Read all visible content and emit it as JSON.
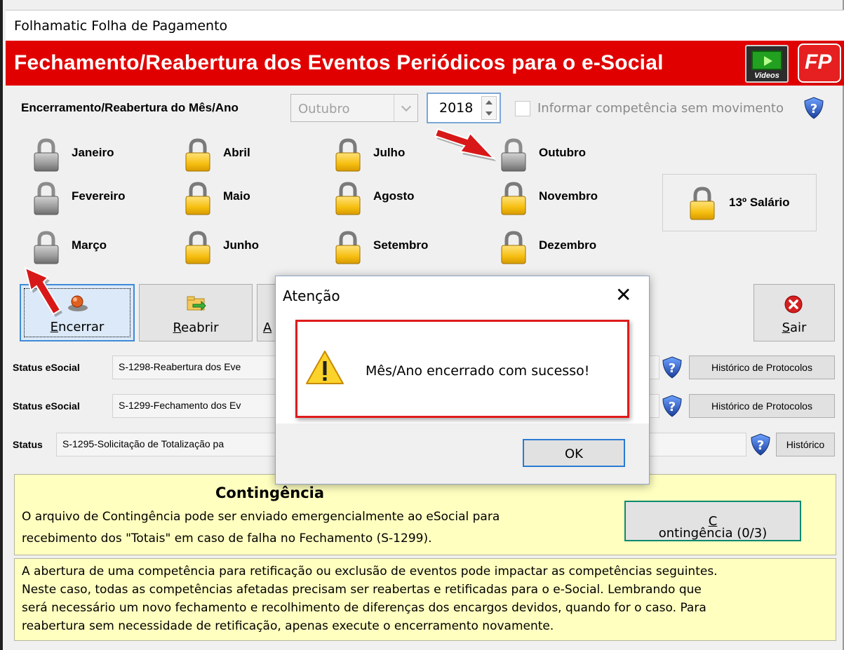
{
  "window": {
    "title": "Folhamatic Folha de Pagamento",
    "banner_title": "Fechamento/Reabertura dos Eventos Periódicos para o e-Social",
    "videos_label": "Videos",
    "fp_label": "FP"
  },
  "period": {
    "label": "Encerramento/Reabertura do Mês/Ano",
    "month_value": "Outubro",
    "year_value": "2018",
    "no_movement_label": "Informar competência sem movimento",
    "no_movement_checked": false
  },
  "months": [
    {
      "label": "Janeiro",
      "state": "closed"
    },
    {
      "label": "Fevereiro",
      "state": "closed"
    },
    {
      "label": "Março",
      "state": "closed"
    },
    {
      "label": "Abril",
      "state": "open"
    },
    {
      "label": "Maio",
      "state": "open"
    },
    {
      "label": "Junho",
      "state": "open"
    },
    {
      "label": "Julho",
      "state": "open"
    },
    {
      "label": "Agosto",
      "state": "open"
    },
    {
      "label": "Setembro",
      "state": "open"
    },
    {
      "label": "Outubro",
      "state": "closed"
    },
    {
      "label": "Novembro",
      "state": "open"
    },
    {
      "label": "Dezembro",
      "state": "open"
    }
  ],
  "salario13": {
    "label": "13º Salário",
    "state": "open"
  },
  "toolbar": {
    "encerrar": {
      "pre": "",
      "hot": "E",
      "post": "ncerrar"
    },
    "reabrir": {
      "pre": "",
      "hot": "R",
      "post": "eabrir"
    },
    "third_partial": "A",
    "sair": {
      "pre": "",
      "hot": "S",
      "post": "air"
    }
  },
  "status": {
    "row1_label": "Status eSocial",
    "row1_value": "S-1298-Reabertura dos Eve",
    "row2_label": "Status eSocial",
    "row2_value": "S-1299-Fechamento dos Ev",
    "row3_label": "Status",
    "row3_value": "S-1295-Solicitação de Totalização pa",
    "historico_protocolos": "Histórico de Protocolos",
    "historico": "Histórico"
  },
  "contingencia": {
    "title": "Contingência",
    "line1": "O arquivo de Contingência pode ser enviado emergencialmente ao eSocial para",
    "line2": "recebimento dos \"Totais\" em caso de falha no Fechamento (S-1299).",
    "button": {
      "hot": "C",
      "post": "ontingência (0/3)"
    }
  },
  "note": {
    "lines": [
      "A abertura de uma competência para retificação ou exclusão de eventos pode impactar as competências seguintes.",
      "Neste caso, todas as competências afetadas precisam ser reabertas e retificadas para o e-Social. Lembrando que",
      "será necessário um novo fechamento e recolhimento de diferenças dos encargos devidos, quando for o caso. Para",
      "reabertura sem necessidade de retificação, apenas execute o encerramento novamente."
    ]
  },
  "dialog": {
    "title": "Atenção",
    "close_glyph": "✕",
    "message": "Mês/Ano encerrado com sucesso!",
    "ok_label": "OK"
  },
  "colors": {
    "banner_red": "#e00000",
    "lock_gold": "#f6c20c",
    "lock_gray": "#9c9c9c",
    "highlight_red": "#e01b1b",
    "panel_yellow": "#ffffc0",
    "focus_blue": "#2b7bd3"
  }
}
